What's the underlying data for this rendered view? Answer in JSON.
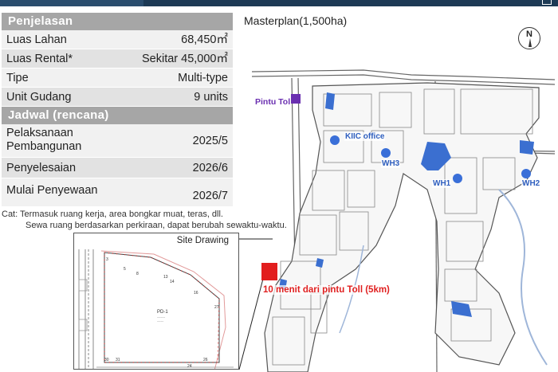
{
  "table": {
    "section1": "Penjelasan",
    "rows1": [
      {
        "k": "Luas Lahan",
        "v": "68,450㎡"
      },
      {
        "k": "Luas Rental*",
        "v": "Sekitar 45,000㎡"
      },
      {
        "k": "Tipe",
        "v": "Multi-type"
      },
      {
        "k": "Unit Gudang",
        "v": "9 units"
      }
    ],
    "section2": "Jadwal (rencana)",
    "rows2": [
      {
        "k1": "Pelaksanaan",
        "k2": "Pembangunan",
        "v": "2025/5"
      },
      {
        "k": "Penyelesaian",
        "v": "2026/6"
      },
      {
        "k": "Mulai Penyewaan",
        "v": "2026/7"
      }
    ]
  },
  "note": {
    "line1": "Cat:  Termasuk ruang kerja, area bongkar muat, teras, dll.",
    "line2": "Sewa ruang berdasarkan perkiraan, dapat berubah sewaktu-waktu."
  },
  "site_drawing": {
    "title": "Site Drawing",
    "plot_label": "PD-1",
    "numbers": [
      "3",
      "5",
      "8",
      "13",
      "14",
      "16",
      "27",
      "24",
      "26",
      "31",
      "30"
    ]
  },
  "map": {
    "title": "Masterplan(1,500ha)",
    "compass": "N",
    "toll_label": "Pintu Tol",
    "office_label": "KIIC office",
    "wh3": "WH3",
    "wh1": "WH1",
    "wh2": "WH2",
    "distance_label": "10 menit dari pintu Toll (5km)"
  },
  "colors": {
    "header_gray": "#a6a6a6",
    "row_light": "#f1f1f1",
    "row_dark": "#e2e2e2",
    "blue_label": "#2f5fbf",
    "toll_purple": "#6a2fb0",
    "site_red": "#e21e1e"
  }
}
